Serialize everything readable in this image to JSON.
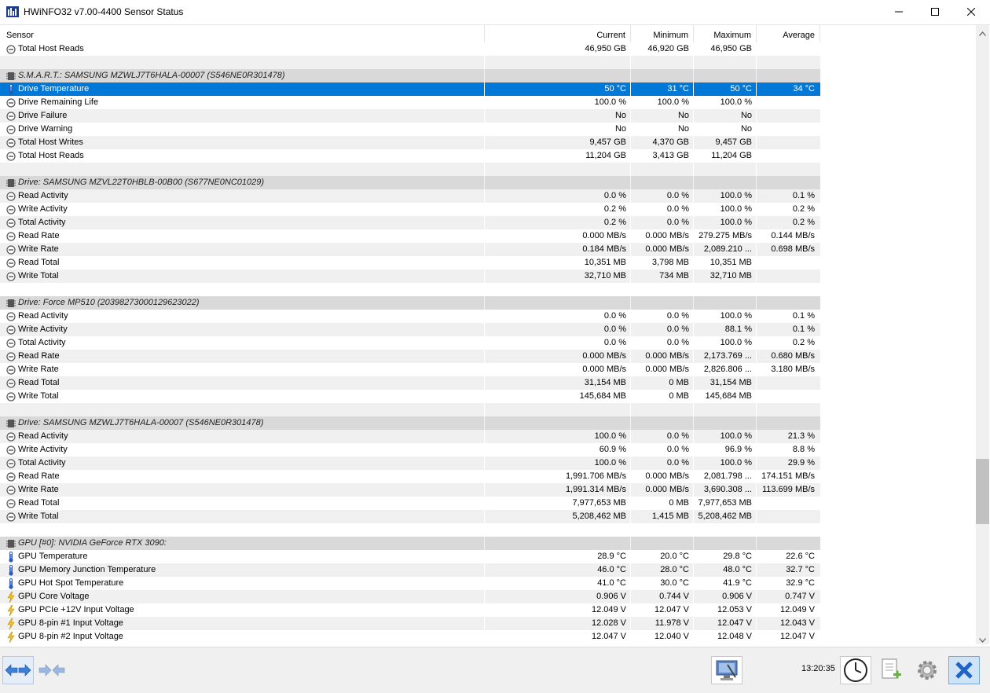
{
  "window": {
    "title": "HWiNFO32 v7.00-4400 Sensor Status"
  },
  "columns": [
    "Sensor",
    "Current",
    "Minimum",
    "Maximum",
    "Average"
  ],
  "rows": [
    {
      "type": "sensor",
      "icon": "circle",
      "name": "Total Host Reads",
      "cur": "46,950 GB",
      "min": "46,920 GB",
      "max": "46,950 GB",
      "avg": ""
    },
    {
      "type": "blank"
    },
    {
      "type": "group",
      "name": "S.M.A.R.T.: SAMSUNG MZWLJ7T6HALA-00007 (S546NE0R301478)"
    },
    {
      "type": "sensor",
      "icon": "thermo",
      "selected": true,
      "name": "Drive Temperature",
      "cur": "50 °C",
      "min": "31 °C",
      "max": "50 °C",
      "avg": "34 °C"
    },
    {
      "type": "sensor",
      "icon": "circle",
      "name": "Drive Remaining Life",
      "cur": "100.0 %",
      "min": "100.0 %",
      "max": "100.0 %",
      "avg": ""
    },
    {
      "type": "sensor",
      "icon": "circle",
      "name": "Drive Failure",
      "cur": "No",
      "min": "No",
      "max": "No",
      "avg": ""
    },
    {
      "type": "sensor",
      "icon": "circle",
      "name": "Drive Warning",
      "cur": "No",
      "min": "No",
      "max": "No",
      "avg": ""
    },
    {
      "type": "sensor",
      "icon": "circle",
      "name": "Total Host Writes",
      "cur": "9,457 GB",
      "min": "4,370 GB",
      "max": "9,457 GB",
      "avg": ""
    },
    {
      "type": "sensor",
      "icon": "circle",
      "name": "Total Host Reads",
      "cur": "11,204 GB",
      "min": "3,413 GB",
      "max": "11,204 GB",
      "avg": ""
    },
    {
      "type": "blank"
    },
    {
      "type": "group",
      "name": "Drive: SAMSUNG MZVL22T0HBLB-00B00 (S677NE0NC01029)"
    },
    {
      "type": "sensor",
      "icon": "circle",
      "name": "Read Activity",
      "cur": "0.0 %",
      "min": "0.0 %",
      "max": "100.0 %",
      "avg": "0.1 %"
    },
    {
      "type": "sensor",
      "icon": "circle",
      "name": "Write Activity",
      "cur": "0.2 %",
      "min": "0.0 %",
      "max": "100.0 %",
      "avg": "0.2 %"
    },
    {
      "type": "sensor",
      "icon": "circle",
      "name": "Total Activity",
      "cur": "0.2 %",
      "min": "0.0 %",
      "max": "100.0 %",
      "avg": "0.2 %"
    },
    {
      "type": "sensor",
      "icon": "circle",
      "name": "Read Rate",
      "cur": "0.000 MB/s",
      "min": "0.000 MB/s",
      "max": "279.275 MB/s",
      "avg": "0.144 MB/s"
    },
    {
      "type": "sensor",
      "icon": "circle",
      "name": "Write Rate",
      "cur": "0.184 MB/s",
      "min": "0.000 MB/s",
      "max": "2,089.210 ...",
      "avg": "0.698 MB/s"
    },
    {
      "type": "sensor",
      "icon": "circle",
      "name": "Read Total",
      "cur": "10,351 MB",
      "min": "3,798 MB",
      "max": "10,351 MB",
      "avg": ""
    },
    {
      "type": "sensor",
      "icon": "circle",
      "name": "Write Total",
      "cur": "32,710 MB",
      "min": "734 MB",
      "max": "32,710 MB",
      "avg": ""
    },
    {
      "type": "blank"
    },
    {
      "type": "group",
      "name": "Drive: Force MP510 (20398273000129623022)"
    },
    {
      "type": "sensor",
      "icon": "circle",
      "name": "Read Activity",
      "cur": "0.0 %",
      "min": "0.0 %",
      "max": "100.0 %",
      "avg": "0.1 %"
    },
    {
      "type": "sensor",
      "icon": "circle",
      "name": "Write Activity",
      "cur": "0.0 %",
      "min": "0.0 %",
      "max": "88.1 %",
      "avg": "0.1 %"
    },
    {
      "type": "sensor",
      "icon": "circle",
      "name": "Total Activity",
      "cur": "0.0 %",
      "min": "0.0 %",
      "max": "100.0 %",
      "avg": "0.2 %"
    },
    {
      "type": "sensor",
      "icon": "circle",
      "name": "Read Rate",
      "cur": "0.000 MB/s",
      "min": "0.000 MB/s",
      "max": "2,173.769 ...",
      "avg": "0.680 MB/s"
    },
    {
      "type": "sensor",
      "icon": "circle",
      "name": "Write Rate",
      "cur": "0.000 MB/s",
      "min": "0.000 MB/s",
      "max": "2,826.806 ...",
      "avg": "3.180 MB/s"
    },
    {
      "type": "sensor",
      "icon": "circle",
      "name": "Read Total",
      "cur": "31,154 MB",
      "min": "0 MB",
      "max": "31,154 MB",
      "avg": ""
    },
    {
      "type": "sensor",
      "icon": "circle",
      "name": "Write Total",
      "cur": "145,684 MB",
      "min": "0 MB",
      "max": "145,684 MB",
      "avg": ""
    },
    {
      "type": "blank"
    },
    {
      "type": "group",
      "name": "Drive: SAMSUNG MZWLJ7T6HALA-00007 (S546NE0R301478)"
    },
    {
      "type": "sensor",
      "icon": "circle",
      "name": "Read Activity",
      "cur": "100.0 %",
      "min": "0.0 %",
      "max": "100.0 %",
      "avg": "21.3 %"
    },
    {
      "type": "sensor",
      "icon": "circle",
      "name": "Write Activity",
      "cur": "60.9 %",
      "min": "0.0 %",
      "max": "96.9 %",
      "avg": "8.8 %"
    },
    {
      "type": "sensor",
      "icon": "circle",
      "name": "Total Activity",
      "cur": "100.0 %",
      "min": "0.0 %",
      "max": "100.0 %",
      "avg": "29.9 %"
    },
    {
      "type": "sensor",
      "icon": "circle",
      "name": "Read Rate",
      "cur": "1,991.706 MB/s",
      "min": "0.000 MB/s",
      "max": "2,081.798 ...",
      "avg": "174.151 MB/s"
    },
    {
      "type": "sensor",
      "icon": "circle",
      "name": "Write Rate",
      "cur": "1,991.314 MB/s",
      "min": "0.000 MB/s",
      "max": "3,690.308 ...",
      "avg": "113.699 MB/s"
    },
    {
      "type": "sensor",
      "icon": "circle",
      "name": "Read Total",
      "cur": "7,977,653 MB",
      "min": "0 MB",
      "max": "7,977,653 MB",
      "avg": ""
    },
    {
      "type": "sensor",
      "icon": "circle",
      "name": "Write Total",
      "cur": "5,208,462 MB",
      "min": "1,415 MB",
      "max": "5,208,462 MB",
      "avg": ""
    },
    {
      "type": "blank"
    },
    {
      "type": "group",
      "name": "GPU [#0]: NVIDIA GeForce RTX 3090:"
    },
    {
      "type": "sensor",
      "icon": "thermo",
      "name": "GPU Temperature",
      "cur": "28.9 °C",
      "min": "20.0 °C",
      "max": "29.8 °C",
      "avg": "22.6 °C"
    },
    {
      "type": "sensor",
      "icon": "thermo",
      "name": "GPU Memory Junction Temperature",
      "cur": "46.0 °C",
      "min": "28.0 °C",
      "max": "48.0 °C",
      "avg": "32.7 °C"
    },
    {
      "type": "sensor",
      "icon": "thermo",
      "name": "GPU Hot Spot Temperature",
      "cur": "41.0 °C",
      "min": "30.0 °C",
      "max": "41.9 °C",
      "avg": "32.9 °C"
    },
    {
      "type": "sensor",
      "icon": "bolt",
      "name": "GPU Core Voltage",
      "cur": "0.906 V",
      "min": "0.744 V",
      "max": "0.906 V",
      "avg": "0.747 V"
    },
    {
      "type": "sensor",
      "icon": "bolt",
      "name": "GPU PCIe +12V Input Voltage",
      "cur": "12.049 V",
      "min": "12.047 V",
      "max": "12.053 V",
      "avg": "12.049 V"
    },
    {
      "type": "sensor",
      "icon": "bolt",
      "name": "GPU 8-pin #1 Input Voltage",
      "cur": "12.028 V",
      "min": "11.978 V",
      "max": "12.047 V",
      "avg": "12.043 V"
    },
    {
      "type": "sensor",
      "icon": "bolt",
      "name": "GPU 8-pin #2 Input Voltage",
      "cur": "12.047 V",
      "min": "12.040 V",
      "max": "12.048 V",
      "avg": "12.047 V"
    }
  ],
  "status": {
    "clock": "13:20:35"
  },
  "colors": {
    "selection": "#0078d7",
    "group_bg": "#d9d9d9",
    "shade": "#f0f0f0"
  }
}
